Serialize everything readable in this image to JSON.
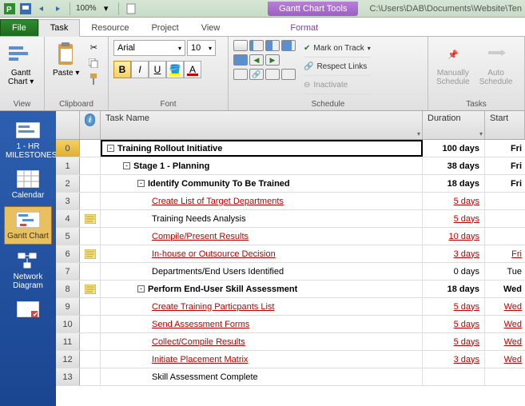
{
  "qat": {
    "zoom": "100%",
    "context_tool": "Gantt Chart Tools",
    "path": "C:\\Users\\DAB\\Documents\\Website\\Ten"
  },
  "tabs": {
    "file": "File",
    "task": "Task",
    "resource": "Resource",
    "project": "Project",
    "view": "View",
    "format": "Format"
  },
  "ribbon": {
    "view": {
      "gantt_label": "Gantt\nChart",
      "group": "View"
    },
    "clipboard": {
      "paste": "Paste",
      "group": "Clipboard"
    },
    "font": {
      "name": "Arial",
      "size": "10",
      "group": "Font"
    },
    "schedule": {
      "mark_on_track": "Mark on Track",
      "respect_links": "Respect Links",
      "inactivate": "Inactivate",
      "group": "Schedule"
    },
    "tasks": {
      "manual": "Manually\nSchedule",
      "auto": "Auto\nSchedule",
      "group": "Tasks"
    }
  },
  "views": {
    "milestones": "1 - HR MILESTONES",
    "calendar": "Calendar",
    "gantt": "Gantt Chart",
    "network": "Network Diagram"
  },
  "columns": {
    "info": "i",
    "task_name": "Task Name",
    "duration": "Duration",
    "start": "Start"
  },
  "rows": [
    {
      "id": "0",
      "note": false,
      "indent": 0,
      "outline": "-",
      "name": "Training Rollout Initiative",
      "bold": true,
      "link": false,
      "dur": "100 days",
      "dur_red": false,
      "start": "Fri"
    },
    {
      "id": "1",
      "note": false,
      "indent": 1,
      "outline": "-",
      "name": "Stage 1 - Planning",
      "bold": true,
      "link": false,
      "dur": "38 days",
      "dur_red": false,
      "start": "Fri"
    },
    {
      "id": "2",
      "note": false,
      "indent": 2,
      "outline": "-",
      "name": "Identify Community To Be Trained",
      "bold": true,
      "link": false,
      "dur": "18 days",
      "dur_red": false,
      "start": "Fri"
    },
    {
      "id": "3",
      "note": false,
      "indent": 3,
      "outline": "",
      "name": "Create List of Target Departments",
      "bold": false,
      "link": true,
      "dur": "5 days",
      "dur_red": true,
      "start": ""
    },
    {
      "id": "4",
      "note": true,
      "indent": 3,
      "outline": "",
      "name": "Training Needs Analysis",
      "bold": false,
      "link": false,
      "dur": "5 days",
      "dur_red": true,
      "start": ""
    },
    {
      "id": "5",
      "note": false,
      "indent": 3,
      "outline": "",
      "name": "Compile/Present Results",
      "bold": false,
      "link": true,
      "dur": "10 days",
      "dur_red": true,
      "start": ""
    },
    {
      "id": "6",
      "note": true,
      "indent": 3,
      "outline": "",
      "name": "In-house or Outsource Decision",
      "bold": false,
      "link": true,
      "dur": "3 days",
      "dur_red": true,
      "start": "Fri"
    },
    {
      "id": "7",
      "note": false,
      "indent": 3,
      "outline": "",
      "name": "Departments/End Users Identified",
      "bold": false,
      "link": false,
      "dur": "0 days",
      "dur_red": false,
      "start": "Tue"
    },
    {
      "id": "8",
      "note": true,
      "indent": 2,
      "outline": "-",
      "name": "Perform End-User Skill Assessment",
      "bold": true,
      "link": false,
      "dur": "18 days",
      "dur_red": false,
      "start": "Wed"
    },
    {
      "id": "9",
      "note": false,
      "indent": 3,
      "outline": "",
      "name": "Create Training Particpants List",
      "bold": false,
      "link": true,
      "dur": "5 days",
      "dur_red": true,
      "start": "Wed"
    },
    {
      "id": "10",
      "note": false,
      "indent": 3,
      "outline": "",
      "name": "Send Assessment Forms",
      "bold": false,
      "link": true,
      "dur": "5 days",
      "dur_red": true,
      "start": "Wed"
    },
    {
      "id": "11",
      "note": false,
      "indent": 3,
      "outline": "",
      "name": "Collect/Compile Results",
      "bold": false,
      "link": true,
      "dur": "5 days",
      "dur_red": true,
      "start": "Wed"
    },
    {
      "id": "12",
      "note": false,
      "indent": 3,
      "outline": "",
      "name": "Initiate Placement Matrix",
      "bold": false,
      "link": true,
      "dur": "3 days",
      "dur_red": true,
      "start": "Wed"
    },
    {
      "id": "13",
      "note": false,
      "indent": 3,
      "outline": "",
      "name": "Skill Assessment Complete",
      "bold": false,
      "link": false,
      "dur": "",
      "dur_red": false,
      "start": ""
    }
  ]
}
